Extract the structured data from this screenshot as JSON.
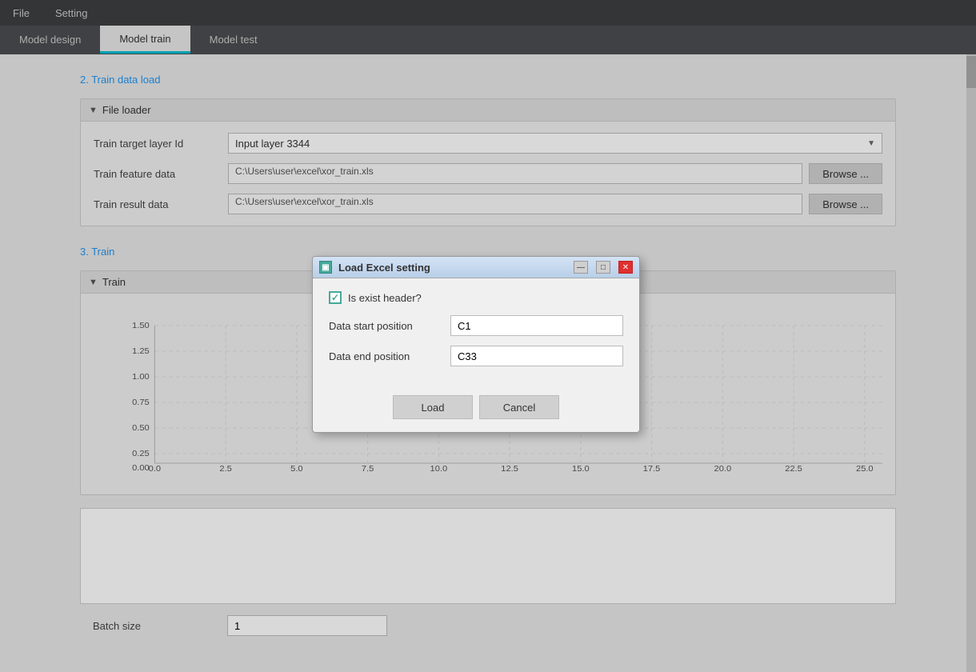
{
  "menu": {
    "items": [
      "File",
      "Setting"
    ]
  },
  "tabs": [
    {
      "id": "model-design",
      "label": "Model design",
      "active": false
    },
    {
      "id": "model-train",
      "label": "Model train",
      "active": true
    },
    {
      "id": "model-test",
      "label": "Model test",
      "active": false
    }
  ],
  "sections": {
    "train_data_load": {
      "heading": "2. Train data load",
      "file_loader": {
        "title": "File loader",
        "train_target_layer": {
          "label": "Train target layer Id",
          "value": "Input layer 3344"
        },
        "train_feature_data": {
          "label": "Train feature data",
          "path": "C:\\Users\\user\\excel\\xor_train.xls",
          "browse_label": "Browse ..."
        },
        "train_result_data": {
          "label": "Train result data",
          "path": "C:\\Users\\user\\excel\\xor_train.xls",
          "browse_label": "Browse ..."
        }
      }
    },
    "train": {
      "heading": "3. Train",
      "train_panel": {
        "title": "Train",
        "chart": {
          "y_labels": [
            "1.50",
            "1.25",
            "1.00",
            "0.75",
            "0.50",
            "0.25",
            "0.00"
          ],
          "x_labels": [
            "0.0",
            "2.5",
            "5.0",
            "7.5",
            "10.0",
            "12.5",
            "15.0",
            "17.5",
            "20.0",
            "22.5",
            "25.0"
          ]
        }
      },
      "batch_size": {
        "label": "Batch size",
        "value": "1"
      }
    }
  },
  "modal": {
    "title": "Load Excel setting",
    "icon_label": "▣",
    "is_exist_header": {
      "label": "Is exist header?",
      "checked": true
    },
    "data_start_position": {
      "label": "Data start position",
      "value": "C1"
    },
    "data_end_position": {
      "label": "Data end position",
      "value": "C33"
    },
    "load_button": "Load",
    "cancel_button": "Cancel"
  }
}
